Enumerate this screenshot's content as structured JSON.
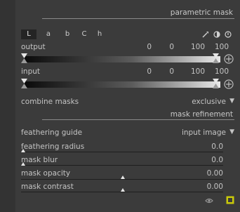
{
  "parametric_mask": {
    "title": "parametric mask",
    "tabs": [
      {
        "label": "L",
        "active": true
      },
      {
        "label": "a",
        "active": false
      },
      {
        "label": "b",
        "active": false
      },
      {
        "label": "C",
        "active": false
      },
      {
        "label": "h",
        "active": false
      }
    ],
    "icons": [
      "color-picker-icon",
      "invert-polarity-icon",
      "reset-icon"
    ],
    "output": {
      "label": "output",
      "values": [
        "0",
        "0",
        "100",
        "100"
      ]
    },
    "input": {
      "label": "input",
      "values": [
        "0",
        "0",
        "100",
        "100"
      ]
    },
    "combine_masks": {
      "label": "combine masks",
      "value": "exclusive"
    }
  },
  "mask_refinement": {
    "title": "mask refinement",
    "feathering_guide": {
      "label": "feathering guide",
      "value": "input image"
    },
    "sliders": [
      {
        "label": "feathering radius",
        "value": "0.0"
      },
      {
        "label": "mask blur",
        "value": "0.0"
      },
      {
        "label": "mask opacity",
        "value": "0.00"
      },
      {
        "label": "mask contrast",
        "value": "0.00"
      }
    ]
  },
  "footer": {
    "icons": [
      "eye-icon",
      "display-mask-icon"
    ]
  },
  "colors": {
    "background": "#3b3b3b",
    "accent_yellow": "#c9c90a"
  }
}
